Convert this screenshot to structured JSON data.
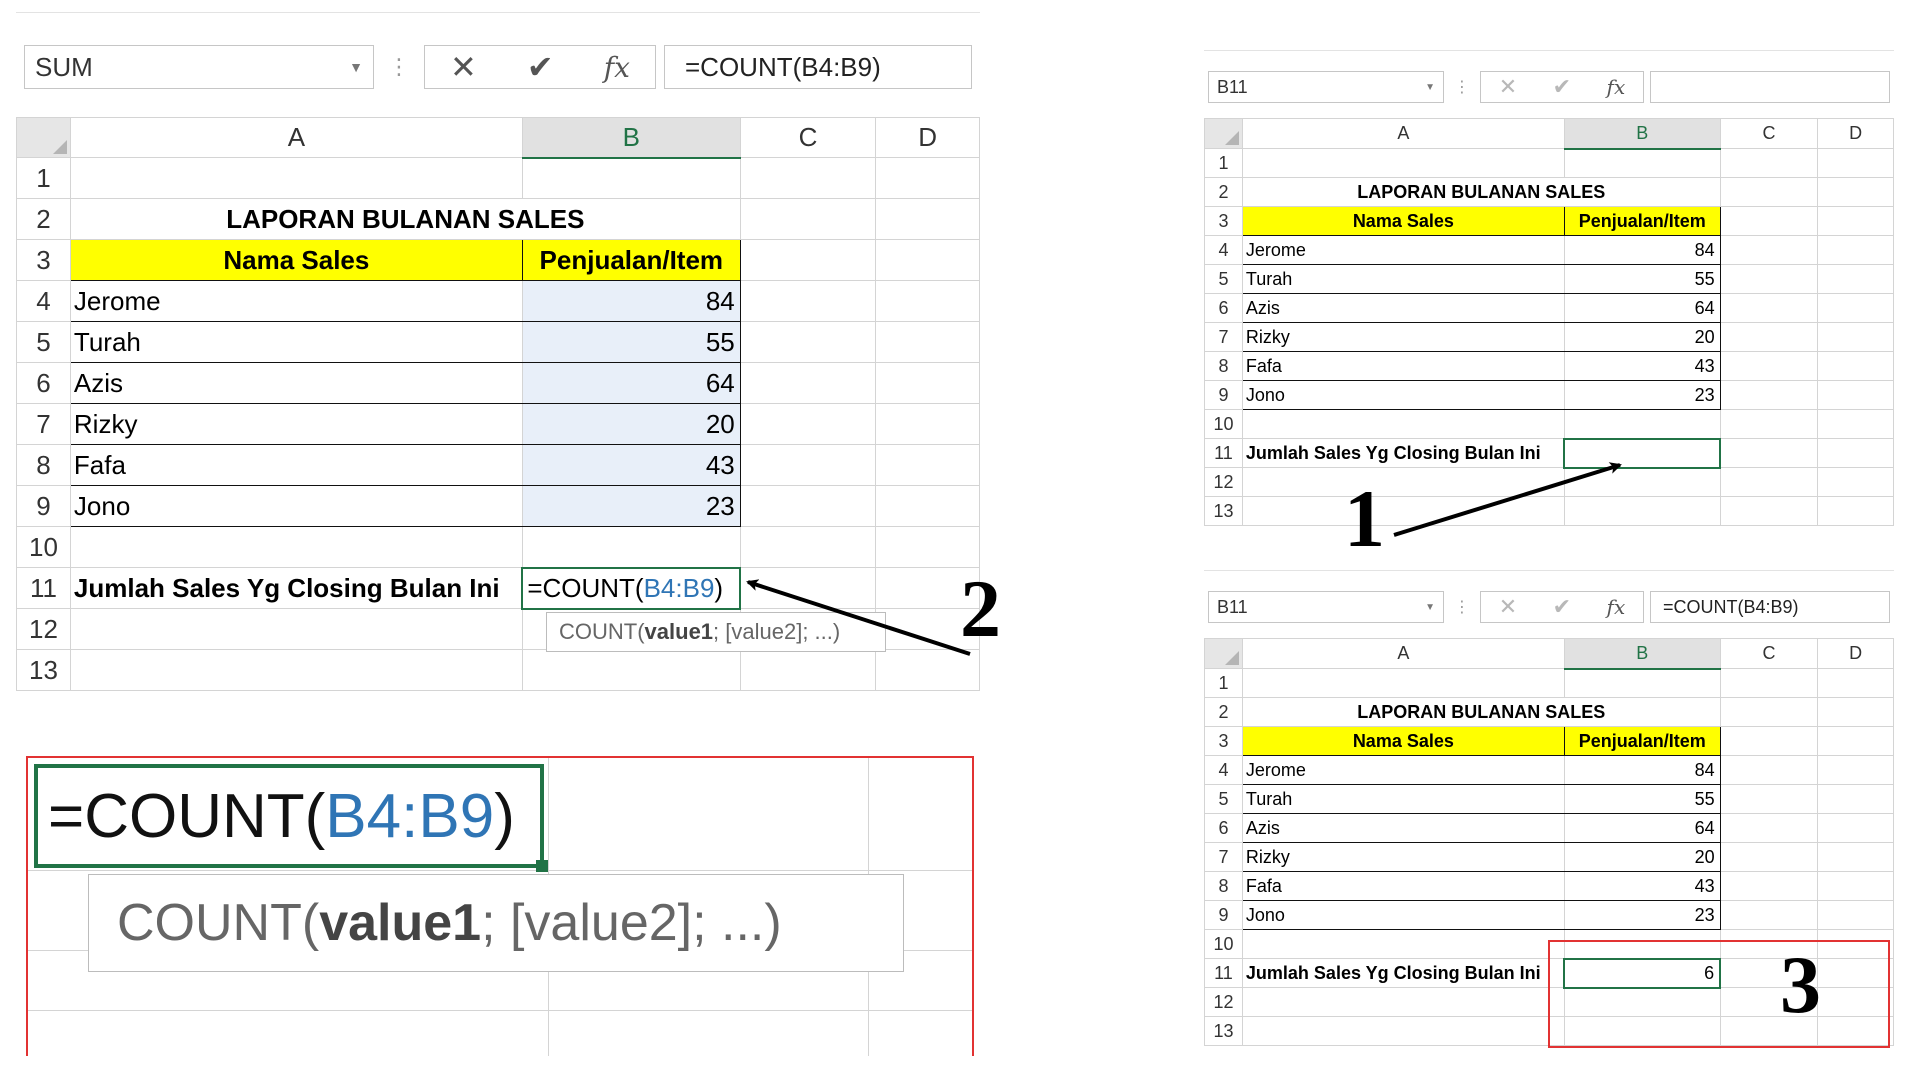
{
  "panel_left": {
    "name_box": "SUM",
    "formula_bar": "=COUNT(B4:B9)",
    "columns": [
      "A",
      "B",
      "C",
      "D"
    ],
    "rows": [
      "1",
      "2",
      "3",
      "4",
      "5",
      "6",
      "7",
      "8",
      "9",
      "10",
      "11",
      "12",
      "13"
    ],
    "title": "LAPORAN BULANAN SALES",
    "headers": {
      "name": "Nama Sales",
      "value": "Penjualan/Item"
    },
    "data": [
      {
        "name": "Jerome",
        "value": "84"
      },
      {
        "name": "Turah",
        "value": "55"
      },
      {
        "name": "Azis",
        "value": "64"
      },
      {
        "name": "Rizky",
        "value": "20"
      },
      {
        "name": "Fafa",
        "value": "43"
      },
      {
        "name": "Jono",
        "value": "23"
      }
    ],
    "label_row11": "Jumlah Sales Yg Closing Bulan Ini",
    "cell_formula": {
      "prefix": "=COUNT(",
      "ref": "B4:B9",
      "suffix": ")"
    },
    "tooltip": {
      "fn": "COUNT(",
      "arg1": "value1",
      "rest": "; [value2]; ...)"
    }
  },
  "zoom_panel": {
    "cell_formula": {
      "prefix": "=COUNT(",
      "ref": "B4:B9",
      "suffix": ")"
    },
    "tooltip": {
      "fn": "COUNT(",
      "arg1": "value1",
      "rest": "; [value2]; ...)"
    }
  },
  "panel_top_right": {
    "name_box": "B11",
    "formula_bar": "",
    "columns": [
      "A",
      "B",
      "C",
      "D"
    ],
    "rows": [
      "1",
      "2",
      "3",
      "4",
      "5",
      "6",
      "7",
      "8",
      "9",
      "10",
      "11",
      "12",
      "13"
    ],
    "title": "LAPORAN BULANAN SALES",
    "headers": {
      "name": "Nama Sales",
      "value": "Penjualan/Item"
    },
    "data": [
      {
        "name": "Jerome",
        "value": "84"
      },
      {
        "name": "Turah",
        "value": "55"
      },
      {
        "name": "Azis",
        "value": "64"
      },
      {
        "name": "Rizky",
        "value": "20"
      },
      {
        "name": "Fafa",
        "value": "43"
      },
      {
        "name": "Jono",
        "value": "23"
      }
    ],
    "label_row11": "Jumlah Sales Yg Closing Bulan Ini",
    "result": ""
  },
  "panel_bottom_right": {
    "name_box": "B11",
    "formula_bar": "=COUNT(B4:B9)",
    "columns": [
      "A",
      "B",
      "C",
      "D"
    ],
    "rows": [
      "1",
      "2",
      "3",
      "4",
      "5",
      "6",
      "7",
      "8",
      "9",
      "10",
      "11",
      "12",
      "13"
    ],
    "title": "LAPORAN BULANAN SALES",
    "headers": {
      "name": "Nama Sales",
      "value": "Penjualan/Item"
    },
    "data": [
      {
        "name": "Jerome",
        "value": "84"
      },
      {
        "name": "Turah",
        "value": "55"
      },
      {
        "name": "Azis",
        "value": "64"
      },
      {
        "name": "Rizky",
        "value": "20"
      },
      {
        "name": "Fafa",
        "value": "43"
      },
      {
        "name": "Jono",
        "value": "23"
      }
    ],
    "label_row11": "Jumlah Sales Yg Closing Bulan Ini",
    "result": "6"
  },
  "step_labels": {
    "one": "1",
    "two": "2",
    "three": "3"
  },
  "icons": {
    "cancel": "close-icon",
    "enter": "check-icon",
    "function": "fx-icon",
    "dropdown": "chevron-down-icon"
  },
  "colors": {
    "header_fill": "#ffff00",
    "selection_green": "#217346",
    "ref_blue": "#2f75b5",
    "highlight_red": "#e23232"
  }
}
